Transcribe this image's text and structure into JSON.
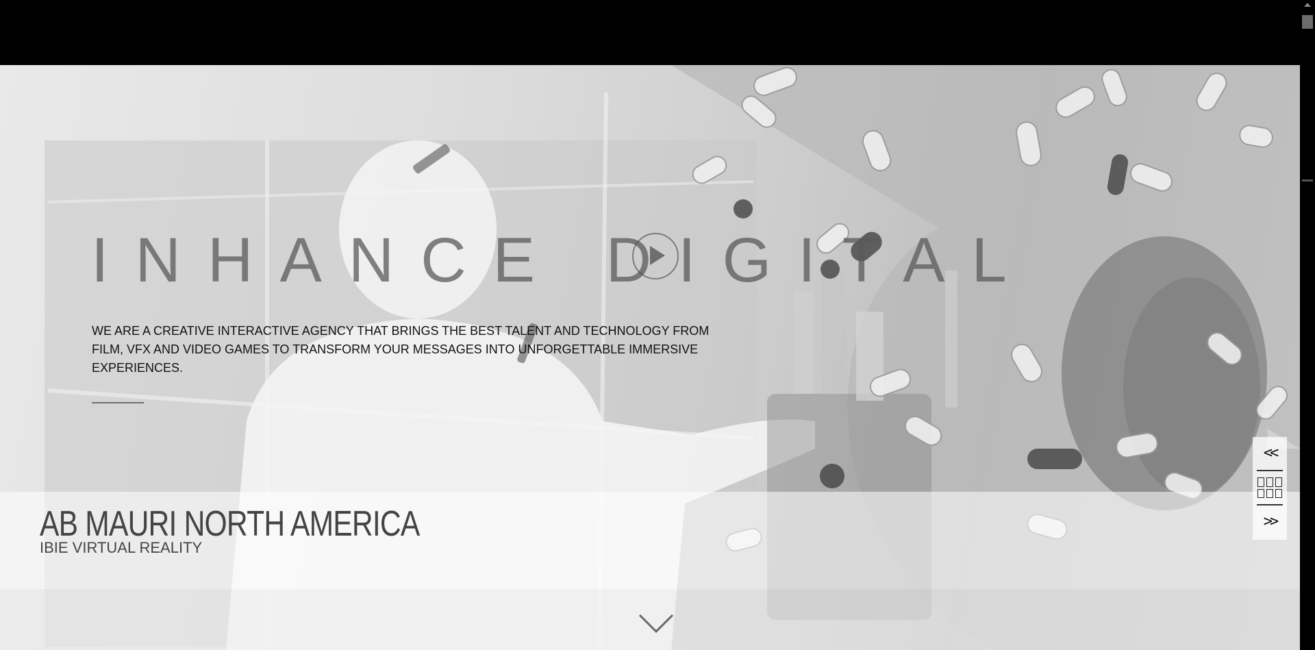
{
  "hero": {
    "brand": "INHANCE DIGITAL",
    "tagline": "WE ARE A CREATIVE INTERACTIVE AGENCY THAT BRINGS THE BEST TALENT AND TECHNOLOGY FROM FILM, VFX AND VIDEO GAMES TO TRANSFORM YOUR MESSAGES INTO UNFORGETTABLE IMMERSIVE EXPERIENCES.",
    "play_icon": "play-circle-icon"
  },
  "slide": {
    "client": "AB MAURI NORTH AMERICA",
    "project": "IBIE VIRTUAL REALITY"
  },
  "slide_nav": {
    "prev": "<<",
    "next": ">>",
    "grid_icon": "grid-icon"
  },
  "scroll_icon": "chevron-down-icon"
}
